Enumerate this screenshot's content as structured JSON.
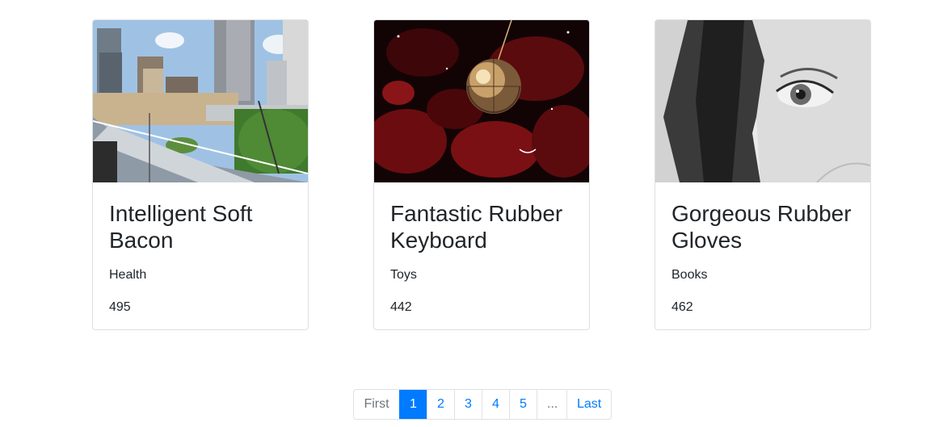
{
  "products": [
    {
      "image_alt": "city skyline photo",
      "title": "Intelligent Soft Bacon",
      "category": "Health",
      "price": "495"
    },
    {
      "image_alt": "disco ball photo",
      "title": "Fantastic Rubber Keyboard",
      "category": "Toys",
      "price": "442"
    },
    {
      "image_alt": "black and white portrait photo",
      "title": "Gorgeous Rubber Gloves",
      "category": "Books",
      "price": "462"
    }
  ],
  "pagination": {
    "first": "First",
    "pages": [
      "1",
      "2",
      "3",
      "4",
      "5"
    ],
    "ellipsis": "...",
    "last": "Last",
    "active_page": "1"
  },
  "colors": {
    "link": "#007bff",
    "active_bg": "#007bff",
    "disabled": "#6c757d",
    "border": "#dee2e6"
  }
}
